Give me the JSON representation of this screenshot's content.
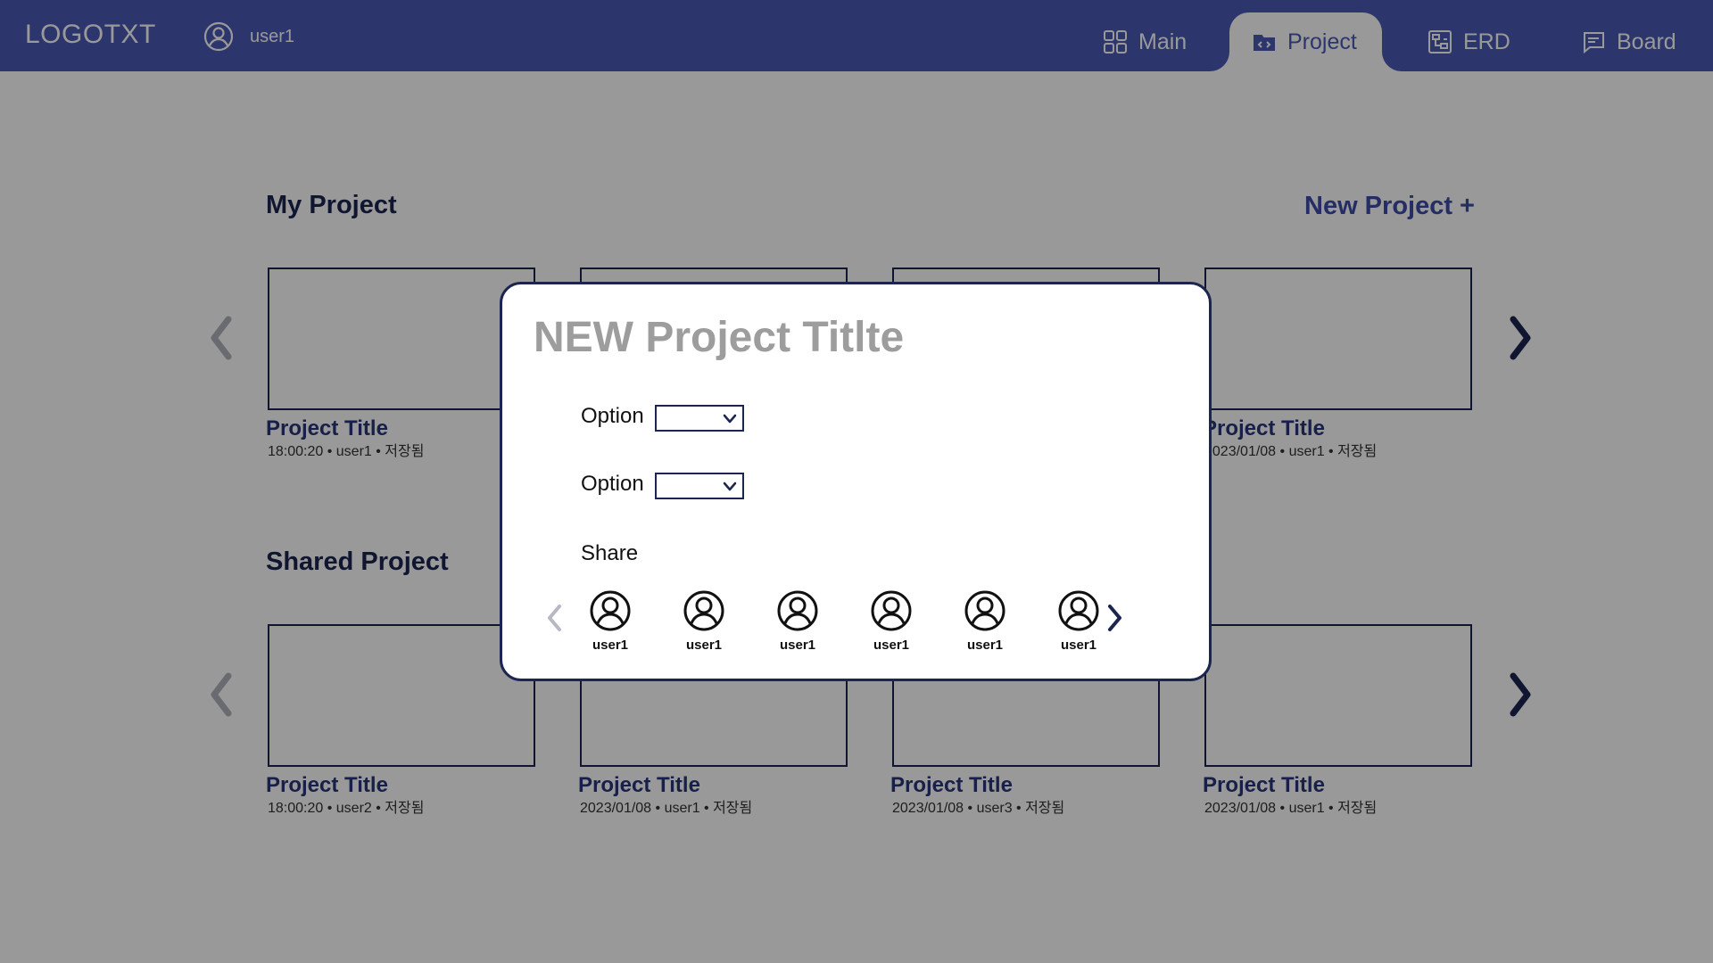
{
  "header": {
    "logo": "LOGOTXT",
    "user": {
      "name": "user1",
      "icon": "user-circle-icon"
    },
    "tabs": [
      {
        "label": "Main",
        "icon": "grid-icon",
        "active": false
      },
      {
        "label": "Project",
        "icon": "folder-code-icon",
        "active": true
      },
      {
        "label": "ERD",
        "icon": "diagram-icon",
        "active": false
      },
      {
        "label": "Board",
        "icon": "chat-board-icon",
        "active": false
      }
    ]
  },
  "my_project": {
    "title": "My Project",
    "new_label": "New Project +",
    "cards": [
      {
        "title": "Project Title",
        "meta": "18:00:20 • user1 • 저장됨"
      },
      {
        "title": "",
        "meta": ""
      },
      {
        "title": "",
        "meta": ""
      },
      {
        "title": "Project Title",
        "meta": "2023/01/08 • user1 • 저장됨"
      }
    ]
  },
  "shared_project": {
    "title": "Shared Project",
    "cards": [
      {
        "title": "Project Title",
        "meta": "18:00:20 • user2 • 저장됨"
      },
      {
        "title": "Project Title",
        "meta": "2023/01/08 • user1 • 저장됨"
      },
      {
        "title": "Project Title",
        "meta": "2023/01/08 • user3 • 저장됨"
      },
      {
        "title": "Project Title",
        "meta": "2023/01/08 • user1 • 저장됨"
      }
    ]
  },
  "modal": {
    "title": "NEW Project Titlte",
    "options": [
      {
        "label": "Option",
        "value": ""
      },
      {
        "label": "Option",
        "value": ""
      }
    ],
    "share_label": "Share",
    "share_users": [
      "user1",
      "user1",
      "user1",
      "user1",
      "user1",
      "user1"
    ]
  },
  "colors": {
    "header_bg": "#4a5ab6",
    "accent": "#3f4ba8",
    "dark_navy": "#1c2450",
    "overlay": "rgba(0,0,0,0.4)",
    "modal_title": "#9d9d9d"
  }
}
